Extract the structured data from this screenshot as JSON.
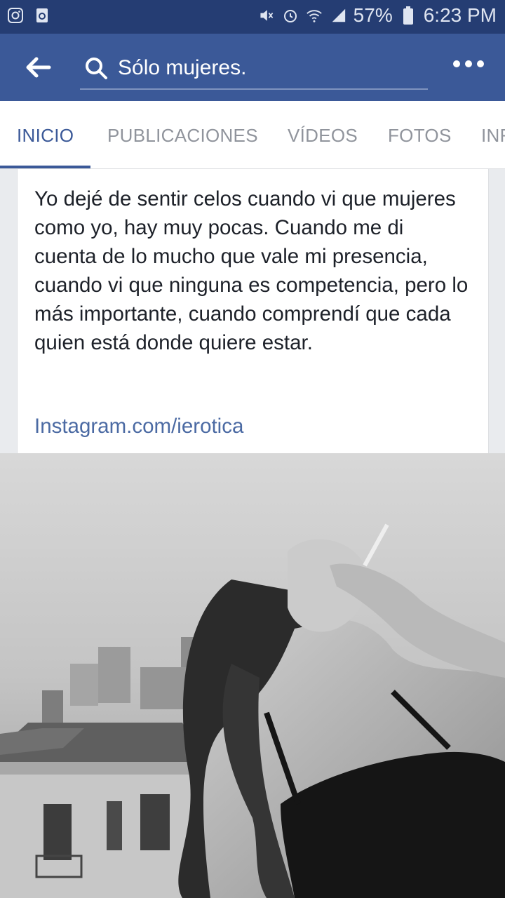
{
  "status_bar": {
    "battery": "57%",
    "time": "6:23 PM",
    "icons": [
      "instagram-icon",
      "recycle-icon",
      "mute-icon",
      "alarm-icon",
      "wifi-icon",
      "signal-icon",
      "battery-icon"
    ]
  },
  "app_bar": {
    "search_query": "Sólo mujeres.",
    "icons": [
      "back-arrow-icon",
      "search-icon",
      "more-icon"
    ]
  },
  "tabs": [
    {
      "label": "INICIO",
      "active": true
    },
    {
      "label": "PUBLICACIONES",
      "active": false
    },
    {
      "label": "VÍDEOS",
      "active": false
    },
    {
      "label": "FOTOS",
      "active": false
    },
    {
      "label": "INF",
      "active": false
    }
  ],
  "post": {
    "text": "Yo dejé de sentir celos cuando vi que mujeres como yo, hay muy pocas. Cuando me di cuenta de lo mucho que vale mi presencia, cuando vi que ninguna es competencia, pero lo más importante, cuando comprendí que cada quien está donde quiere estar.",
    "link": "Instagram.com/ierotica"
  },
  "colors": {
    "facebook_blue": "#3b5998",
    "status_bar": "#253d73",
    "link": "#4b6aa3",
    "tab_inactive": "#90949c"
  }
}
